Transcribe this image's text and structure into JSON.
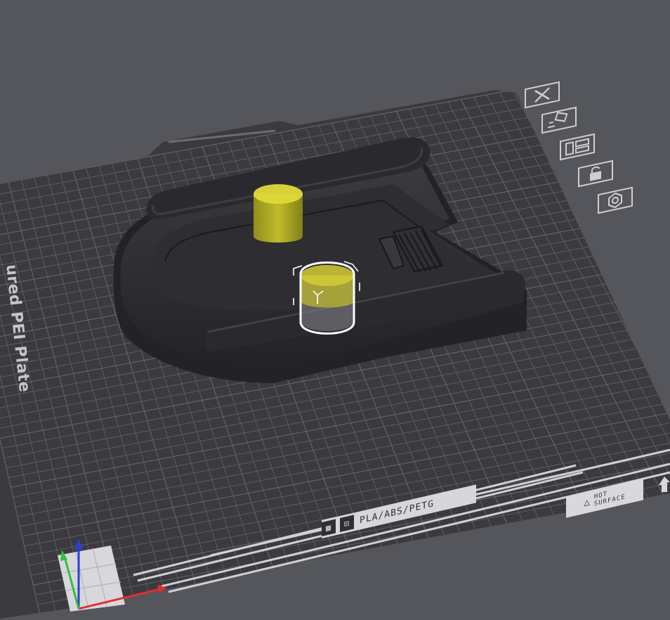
{
  "plate": {
    "name_label": "ured PEI Plate",
    "material_label": "PLA/ABS/PETG",
    "hot_surface_line1": "HOT",
    "hot_surface_line2": "SURFACE"
  },
  "plate_tools": [
    {
      "name": "remove-plate-icon",
      "icon": "close-x"
    },
    {
      "name": "arrange-icon",
      "icon": "arrange"
    },
    {
      "name": "orient-icon",
      "icon": "layout"
    },
    {
      "name": "lock-plate-icon",
      "icon": "lock"
    },
    {
      "name": "plate-settings-icon",
      "icon": "hexagon-gear"
    }
  ],
  "colors": {
    "background": "#55555c",
    "plate": "#39393e",
    "grid": "#5a5a60",
    "model": "#2b2b2f",
    "modifier": "#c8c21a",
    "selection": "#ffffff",
    "axis_x": "#e03030",
    "axis_y": "#30c040",
    "axis_z": "#2b3fd6"
  }
}
